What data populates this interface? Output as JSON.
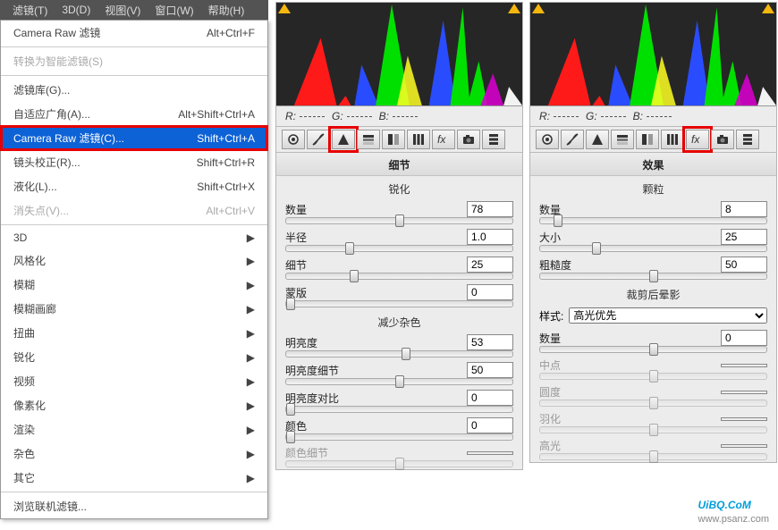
{
  "menubar": [
    "滤镜(T)",
    "3D(D)",
    "视图(V)",
    "窗口(W)",
    "帮助(H)"
  ],
  "menu": {
    "block1": [
      {
        "label": "Camera Raw 滤镜",
        "shortcut": "Alt+Ctrl+F",
        "cls": ""
      }
    ],
    "block2": [
      {
        "label": "转换为智能滤镜(S)",
        "shortcut": "",
        "cls": "disabled"
      }
    ],
    "block3": [
      {
        "label": "滤镜库(G)...",
        "shortcut": "",
        "cls": ""
      },
      {
        "label": "自适应广角(A)...",
        "shortcut": "Alt+Shift+Ctrl+A",
        "cls": ""
      },
      {
        "label": "Camera Raw 滤镜(C)...",
        "shortcut": "Shift+Ctrl+A",
        "cls": "selected highlight-box"
      },
      {
        "label": "镜头校正(R)...",
        "shortcut": "Shift+Ctrl+R",
        "cls": ""
      },
      {
        "label": "液化(L)...",
        "shortcut": "Shift+Ctrl+X",
        "cls": ""
      },
      {
        "label": "消失点(V)...",
        "shortcut": "Alt+Ctrl+V",
        "cls": "disabled"
      }
    ],
    "block4": [
      {
        "label": "3D",
        "sub": true
      },
      {
        "label": "风格化",
        "sub": true
      },
      {
        "label": "模糊",
        "sub": true
      },
      {
        "label": "模糊画廊",
        "sub": true
      },
      {
        "label": "扭曲",
        "sub": true
      },
      {
        "label": "锐化",
        "sub": true
      },
      {
        "label": "视频",
        "sub": true
      },
      {
        "label": "像素化",
        "sub": true
      },
      {
        "label": "渲染",
        "sub": true
      },
      {
        "label": "杂色",
        "sub": true
      },
      {
        "label": "其它",
        "sub": true
      }
    ],
    "block5": [
      {
        "label": "浏览联机滤镜...",
        "shortcut": "",
        "cls": ""
      }
    ]
  },
  "rgb": {
    "r": "R:",
    "g": "G:",
    "b": "B:"
  },
  "panel_left": {
    "title": "细节",
    "h1": "锐化",
    "s1": [
      {
        "label": "数量",
        "val": "78",
        "pos": 50
      },
      {
        "label": "半径",
        "val": "1.0",
        "pos": 28
      },
      {
        "label": "细节",
        "val": "25",
        "pos": 30
      },
      {
        "label": "蒙版",
        "val": "0",
        "pos": 2
      }
    ],
    "h2": "减少杂色",
    "s2": [
      {
        "label": "明亮度",
        "val": "53",
        "pos": 53
      },
      {
        "label": "明亮度细节",
        "val": "50",
        "pos": 50
      },
      {
        "label": "明亮度对比",
        "val": "0",
        "pos": 2
      },
      {
        "label": "颜色",
        "val": "0",
        "pos": 2
      },
      {
        "label": "颜色细节",
        "val": "",
        "pos": 50,
        "disabled": true
      }
    ]
  },
  "panel_right": {
    "title": "效果",
    "h1": "颗粒",
    "s1": [
      {
        "label": "数量",
        "val": "8",
        "pos": 8
      },
      {
        "label": "大小",
        "val": "25",
        "pos": 25
      },
      {
        "label": "粗糙度",
        "val": "50",
        "pos": 50
      }
    ],
    "h2": "裁剪后晕影",
    "style_label": "样式:",
    "style_value": "高光优先",
    "s2": [
      {
        "label": "数量",
        "val": "0",
        "pos": 50
      },
      {
        "label": "中点",
        "val": "",
        "pos": 50,
        "disabled": true
      },
      {
        "label": "圆度",
        "val": "",
        "pos": 50,
        "disabled": true
      },
      {
        "label": "羽化",
        "val": "",
        "pos": 50,
        "disabled": true
      },
      {
        "label": "高光",
        "val": "",
        "pos": 50,
        "disabled": true
      }
    ]
  },
  "watermark": {
    "main": "UiBQ.CoM",
    "sub": "www.psanz.com"
  }
}
